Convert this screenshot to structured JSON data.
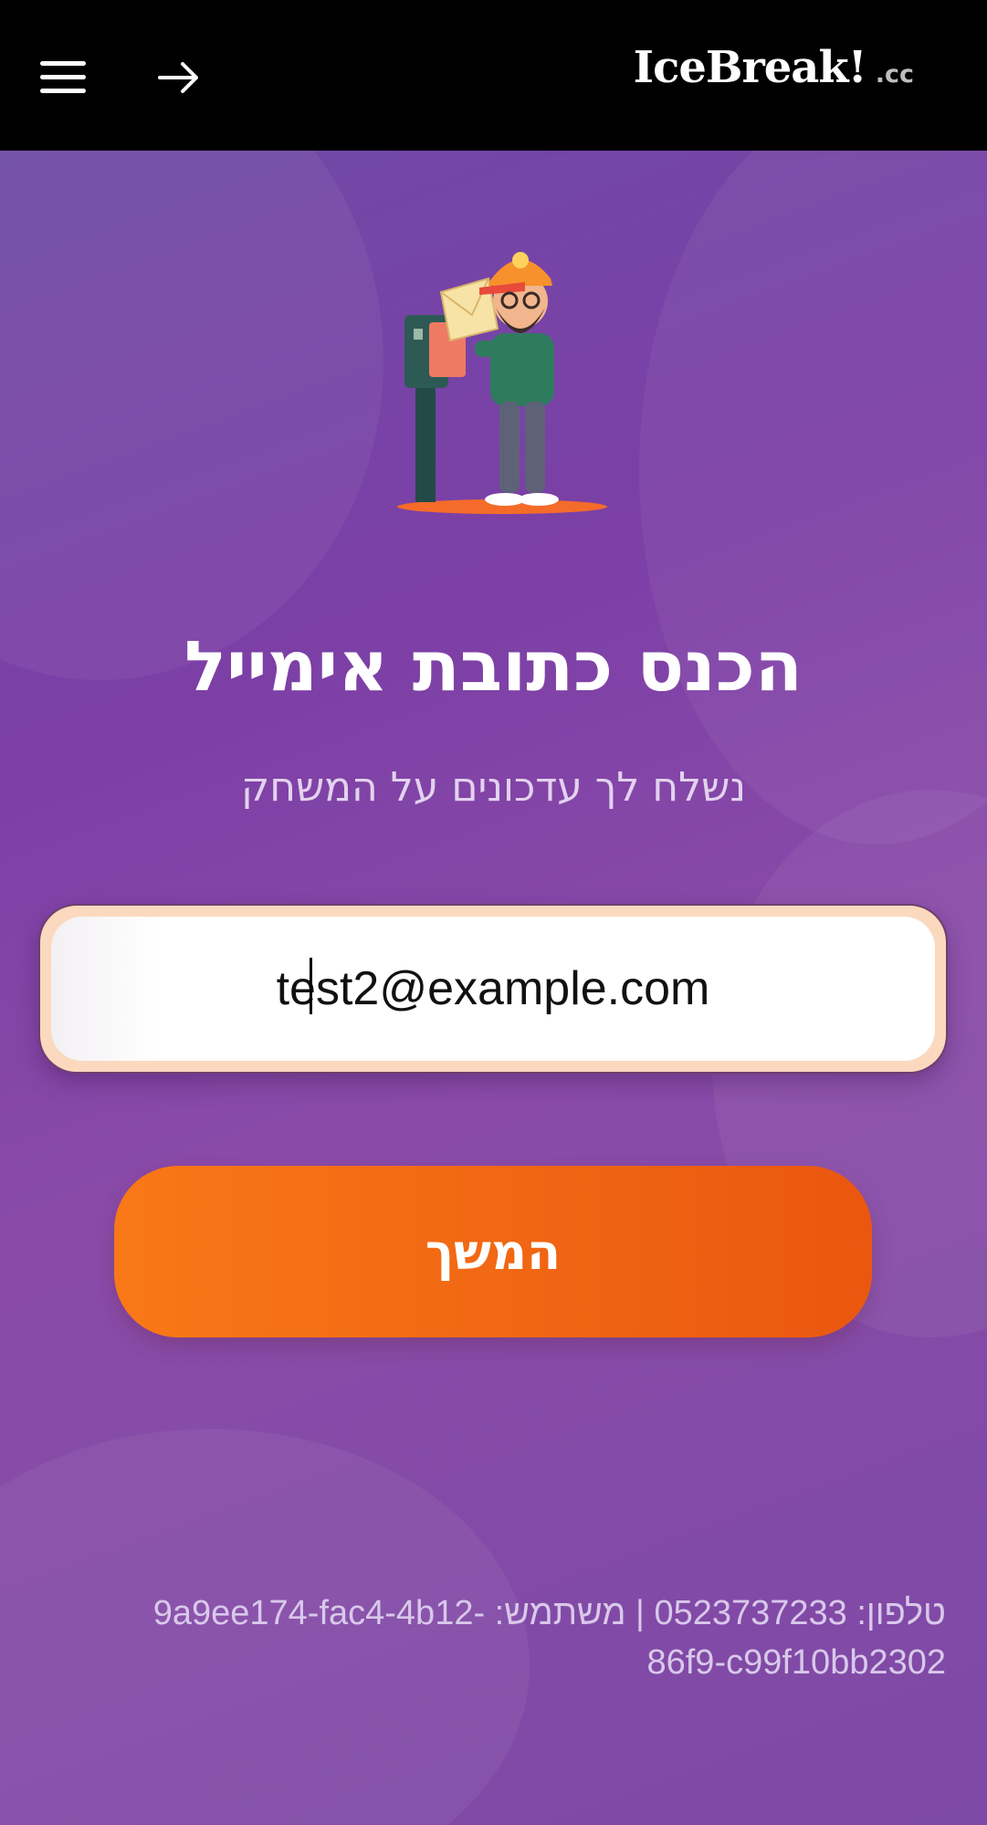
{
  "header": {
    "logo_main": "IceBreak!",
    "logo_suffix": ".cc",
    "menu_icon": "hamburger-menu-icon",
    "back_icon": "arrow-right-icon"
  },
  "main": {
    "illustration": "mailman-mailbox-illustration",
    "headline": "הכנס כתובת אימייל",
    "subline": "נשלח לך עדכונים על המשחק",
    "email_value": "test2@example.com",
    "continue_label": "המשך"
  },
  "footer": {
    "text": "טלפון: 0523737233 | משתמש: 9a9ee174-fac4-4b12-86f9-c99f10bb2302"
  },
  "colors": {
    "topbar": "#000000",
    "background": "#7b46a6",
    "button": "#f26b14",
    "input_border": "#fbd9be"
  }
}
